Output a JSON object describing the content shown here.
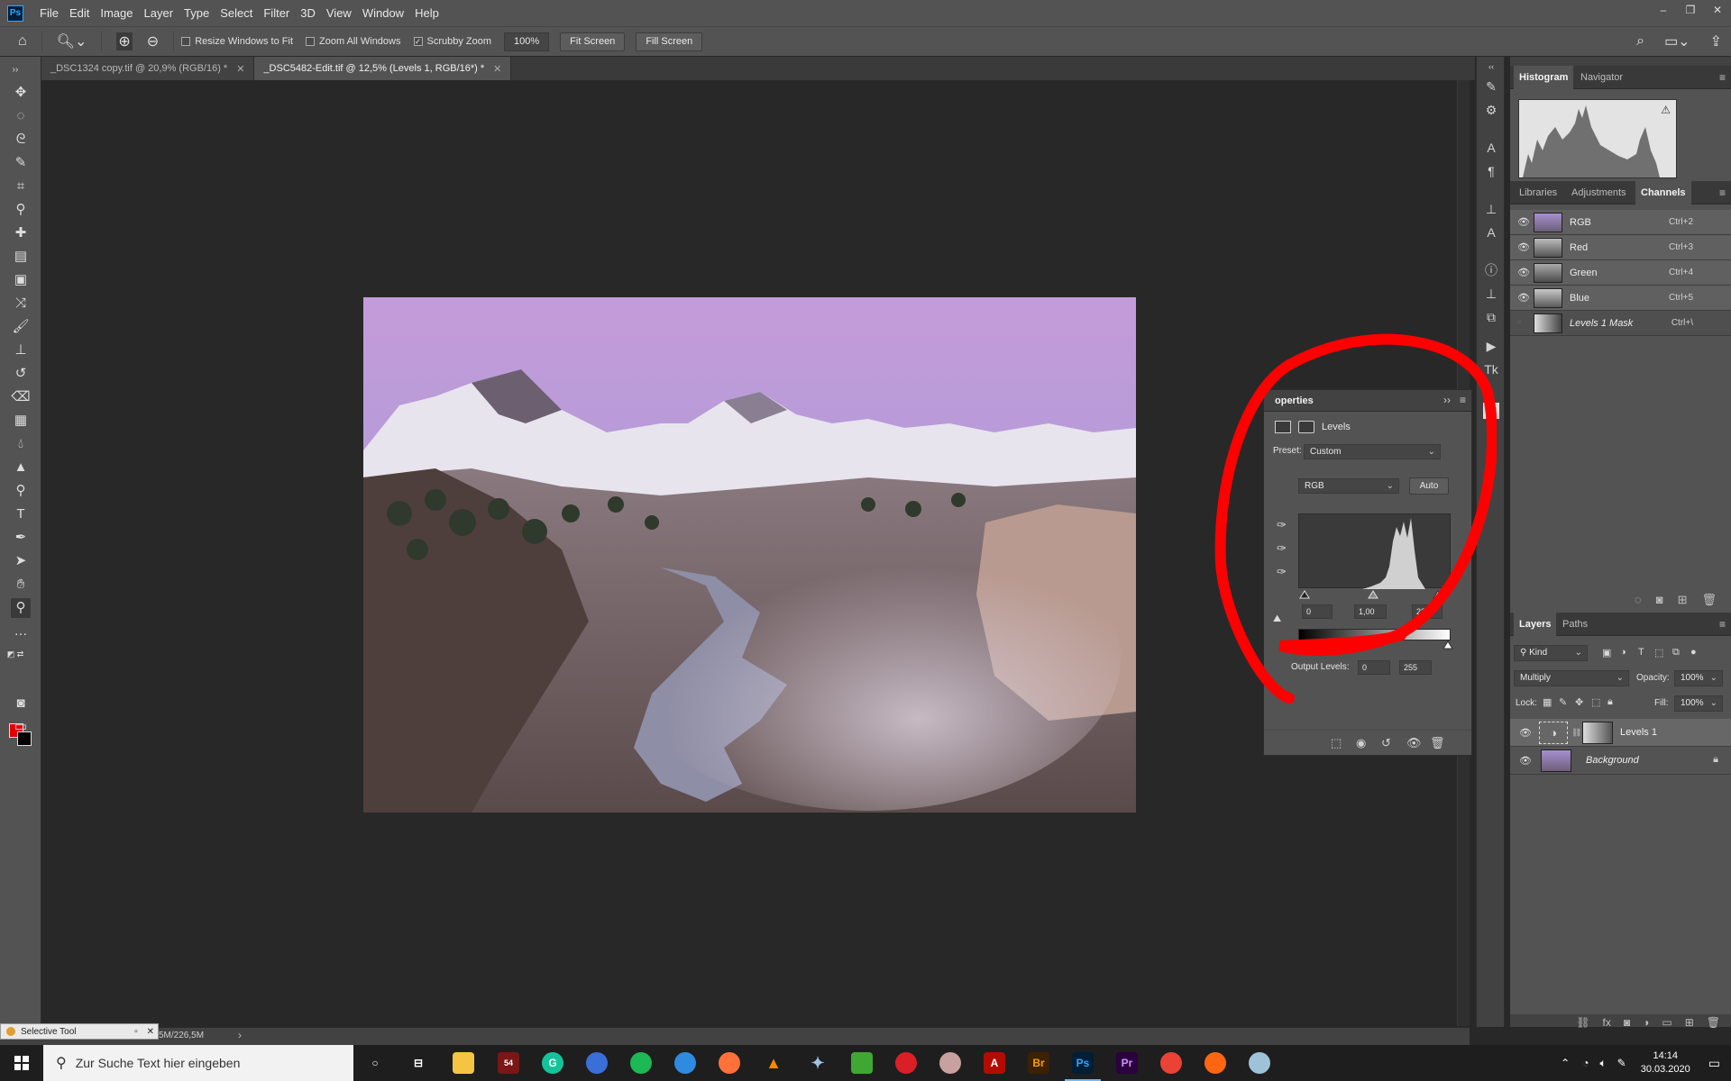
{
  "app": {
    "logo": "Ps",
    "menu": [
      "File",
      "Edit",
      "Image",
      "Layer",
      "Type",
      "Select",
      "Filter",
      "3D",
      "View",
      "Window",
      "Help"
    ]
  },
  "options": {
    "resize_windows": "Resize Windows to Fit",
    "zoom_all": "Zoom All Windows",
    "scrubby_zoom": "Scrubby Zoom",
    "zoom_value": "100%",
    "fit_screen": "Fit Screen",
    "fill_screen": "Fill Screen"
  },
  "tabs": [
    {
      "label": "_DSC1324 copy.tif @ 20,9% (RGB/16) *",
      "active": false
    },
    {
      "label": "_DSC5482-Edit.tif @ 12,5% (Levels 1, RGB/16*) *",
      "active": true
    }
  ],
  "status": {
    "doc_size": "5M/226,5M",
    "floating_window": "Selective Tool"
  },
  "properties": {
    "title": "operties",
    "adjustment": "Levels",
    "preset_label": "Preset:",
    "preset_value": "Custom",
    "channel": "RGB",
    "auto_label": "Auto",
    "input_black": "0",
    "input_gamma": "1,00",
    "input_white": "238",
    "output_label": "Output Levels:",
    "output_black": "0",
    "output_white": "255"
  },
  "histogram_panel": {
    "tabs": [
      "Histogram",
      "Navigator"
    ]
  },
  "channels_panel": {
    "tabs": [
      "Libraries",
      "Adjustments",
      "Channels"
    ],
    "rows": [
      {
        "name": "RGB",
        "shortcut": "Ctrl+2",
        "visible": true
      },
      {
        "name": "Red",
        "shortcut": "Ctrl+3",
        "visible": true
      },
      {
        "name": "Green",
        "shortcut": "Ctrl+4",
        "visible": true
      },
      {
        "name": "Blue",
        "shortcut": "Ctrl+5",
        "visible": true
      },
      {
        "name": "Levels 1 Mask",
        "shortcut": "Ctrl+\\",
        "visible": false
      }
    ]
  },
  "layers_panel": {
    "tabs": [
      "Layers",
      "Paths"
    ],
    "filter_kind": "Kind",
    "blend_mode": "Multiply",
    "opacity_label": "Opacity:",
    "opacity": "100%",
    "lock_label": "Lock:",
    "fill_label": "Fill:",
    "fill": "100%",
    "layers": [
      {
        "name": "Levels 1",
        "selected": true
      },
      {
        "name": "Background",
        "selected": false
      }
    ]
  },
  "taskbar": {
    "search_placeholder": "Zur Suche Text hier eingeben",
    "time": "14:14",
    "date": "30.03.2020",
    "apps": [
      "file-explorer",
      "app-54",
      "grammarly",
      "earth",
      "spotify",
      "edge-like",
      "firefox",
      "vlc",
      "butterfly-app",
      "camtasia",
      "creative-cloud",
      "cloud-app",
      "acrobat",
      "Br",
      "Ps",
      "Pr",
      "chrome",
      "firefox-dev",
      "paint-app"
    ]
  },
  "colors": {
    "foreground": "#e30000",
    "background": "#000000",
    "annotation": "#ff0000"
  }
}
